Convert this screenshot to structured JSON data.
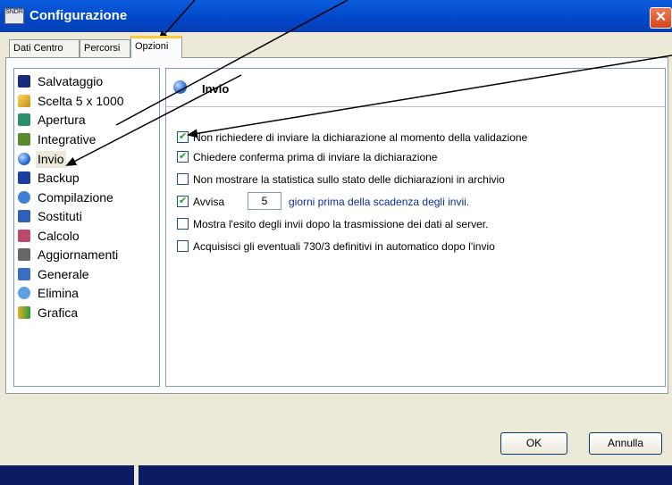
{
  "window": {
    "title": "Configurazione",
    "app_icon_text": "SNDR"
  },
  "tabs": [
    {
      "label": "Dati Centro",
      "active": false
    },
    {
      "label": "Percorsi",
      "active": false
    },
    {
      "label": "Opzioni",
      "active": true
    }
  ],
  "tree": {
    "items": [
      {
        "label": "Salvataggio",
        "icon": "save-icon",
        "selected": false
      },
      {
        "label": "Scelta 5 x 1000",
        "icon": "pencil-icon",
        "selected": false
      },
      {
        "label": "Apertura",
        "icon": "open-icon",
        "selected": false
      },
      {
        "label": "Integrative",
        "icon": "integrative-icon",
        "selected": false
      },
      {
        "label": "Invio",
        "icon": "globe-send-icon",
        "selected": true
      },
      {
        "label": "Backup",
        "icon": "backup-icon",
        "selected": false
      },
      {
        "label": "Compilazione",
        "icon": "compile-icon",
        "selected": false
      },
      {
        "label": "Sostituti",
        "icon": "substitutes-icon",
        "selected": false
      },
      {
        "label": "Calcolo",
        "icon": "calculator-icon",
        "selected": false
      },
      {
        "label": "Aggiornamenti",
        "icon": "updates-icon",
        "selected": false
      },
      {
        "label": "Generale",
        "icon": "computer-icon",
        "selected": false
      },
      {
        "label": "Elimina",
        "icon": "delete-icon",
        "selected": false
      },
      {
        "label": "Grafica",
        "icon": "graphics-icon",
        "selected": false
      }
    ]
  },
  "pane": {
    "title": "Invio",
    "options": [
      {
        "label": "Non richiedere di inviare la dichiarazione al momento della validazione",
        "checked": true
      },
      {
        "label": "Chiedere conferma prima di inviare la dichiarazione",
        "checked": true
      },
      {
        "label": "Non mostrare la statistica sullo stato delle dichiarazioni in archivio",
        "checked": false
      },
      {
        "label": "Avvisa",
        "checked": true,
        "value": "5",
        "suffix": "giorni prima della scadenza degli invii."
      },
      {
        "label": "Mostra l'esito degli invii dopo la trasmissione dei dati al server.",
        "checked": false
      },
      {
        "label": "Acquisisci gli eventuali 730/3 definitivi in automatico dopo l'invio",
        "checked": false
      }
    ]
  },
  "buttons": {
    "ok": "OK",
    "cancel": "Annulla"
  },
  "colors": {
    "title_bar": "#0054e3",
    "status_bar": "#0b1b64",
    "tab_highlight": "#ffc83c"
  }
}
